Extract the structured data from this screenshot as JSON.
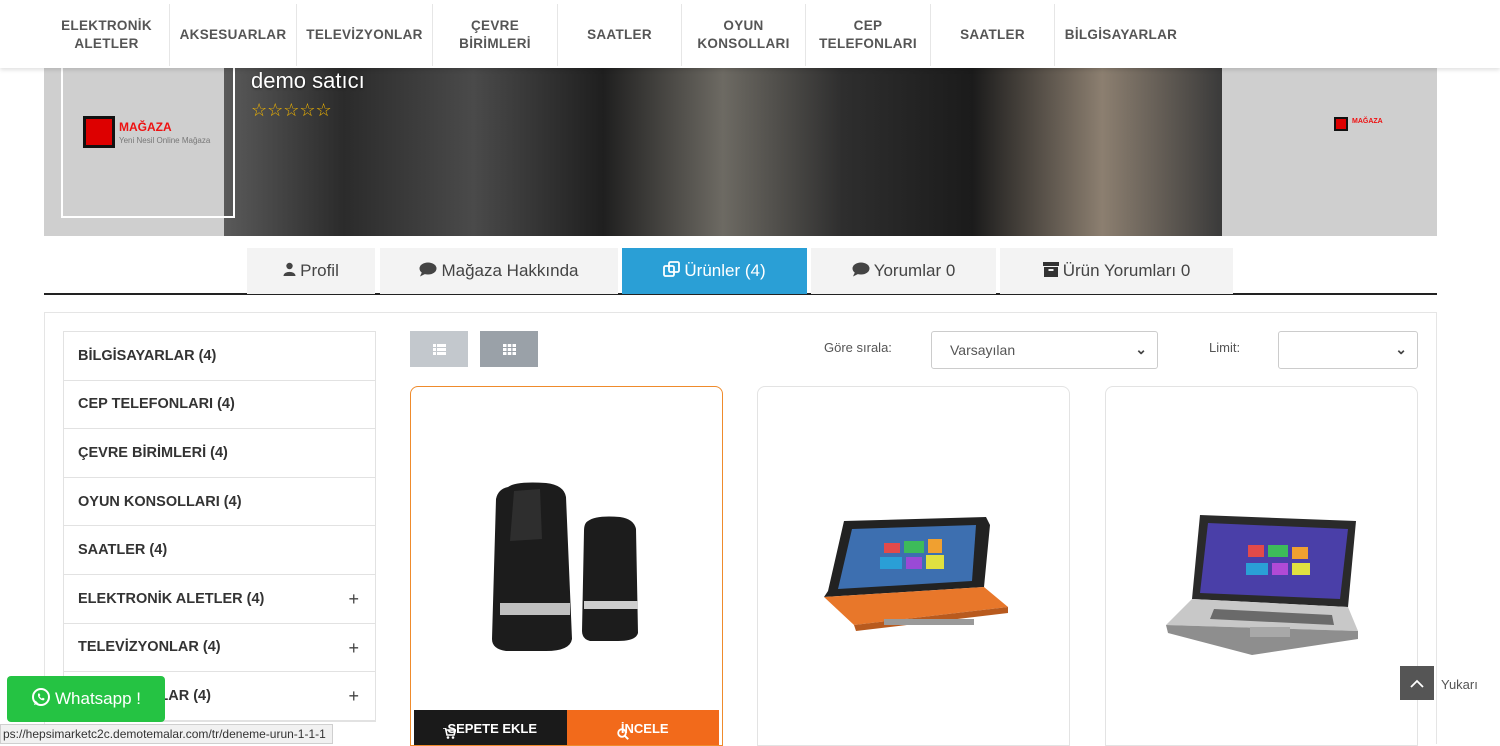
{
  "topnav": {
    "items": [
      {
        "label": "ELEKTRONİK\nALETLER"
      },
      {
        "label": "AKSESUARLAR"
      },
      {
        "label": "TELEVİZYONLAR"
      },
      {
        "label": "ÇEVRE\nBİRİMLERİ"
      },
      {
        "label": "SAATLER"
      },
      {
        "label": "OYUN\nKONSOLLARI"
      },
      {
        "label": "CEP\nTELEFONLARI"
      },
      {
        "label": "SAATLER"
      },
      {
        "label": "BİLGİSAYARLAR"
      }
    ]
  },
  "store": {
    "seller_name": "demo satıcı",
    "rating_stars": "☆☆☆☆☆",
    "rating": 0,
    "logo_text": "MAĞAZA",
    "logo_sub": "Yeni Nesil Online Mağaza"
  },
  "tabs": [
    {
      "icon": "user-icon",
      "glyph": "👤",
      "label": "Profil"
    },
    {
      "icon": "comment-icon",
      "glyph": "💬",
      "label": "Mağaza Hakkında"
    },
    {
      "icon": "clone-icon",
      "glyph": "⧉",
      "label": "Ürünler (4)"
    },
    {
      "icon": "comment-icon",
      "glyph": "💬",
      "label": "Yorumlar 0"
    },
    {
      "icon": "archive-icon",
      "glyph": "▀",
      "label": "Ürün Yorumları 0"
    }
  ],
  "categories": [
    {
      "label": "BİLGİSAYARLAR (4)",
      "expandable": false
    },
    {
      "label": "CEP TELEFONLARI (4)",
      "expandable": false
    },
    {
      "label": "ÇEVRE BİRİMLERİ (4)",
      "expandable": false
    },
    {
      "label": "OYUN KONSOLLARI (4)",
      "expandable": false
    },
    {
      "label": "SAATLER (4)",
      "expandable": false
    },
    {
      "label": "ELEKTRONİK ALETLER (4)",
      "expandable": true
    },
    {
      "label": "TELEVİZYONLAR (4)",
      "expandable": true
    },
    {
      "label": "AKSESUARLAR (4)",
      "expandable": true
    }
  ],
  "toolbar": {
    "list_view_icon": "list-icon",
    "grid_view_icon": "grid-icon",
    "sort_label": "Göre sırala:",
    "sort_value": "Varsayılan",
    "limit_label": "Limit:",
    "limit_value": ""
  },
  "products": [
    {
      "image": "speakers",
      "cart_label": "SEPETE EKLE",
      "view_label": "İNCELE"
    },
    {
      "image": "orange-convertible-laptop"
    },
    {
      "image": "silver-laptop"
    }
  ],
  "whatsapp": {
    "label": "Whatsapp !"
  },
  "status_url": "ps://hepsimarketc2c.demotemalar.com/tr/deneme-urun-1-1-1",
  "totop": {
    "label": "Yukarı"
  },
  "colors": {
    "accent": "#2a9fd6",
    "orange": "#f26a1b",
    "whatsapp": "#25c343"
  }
}
